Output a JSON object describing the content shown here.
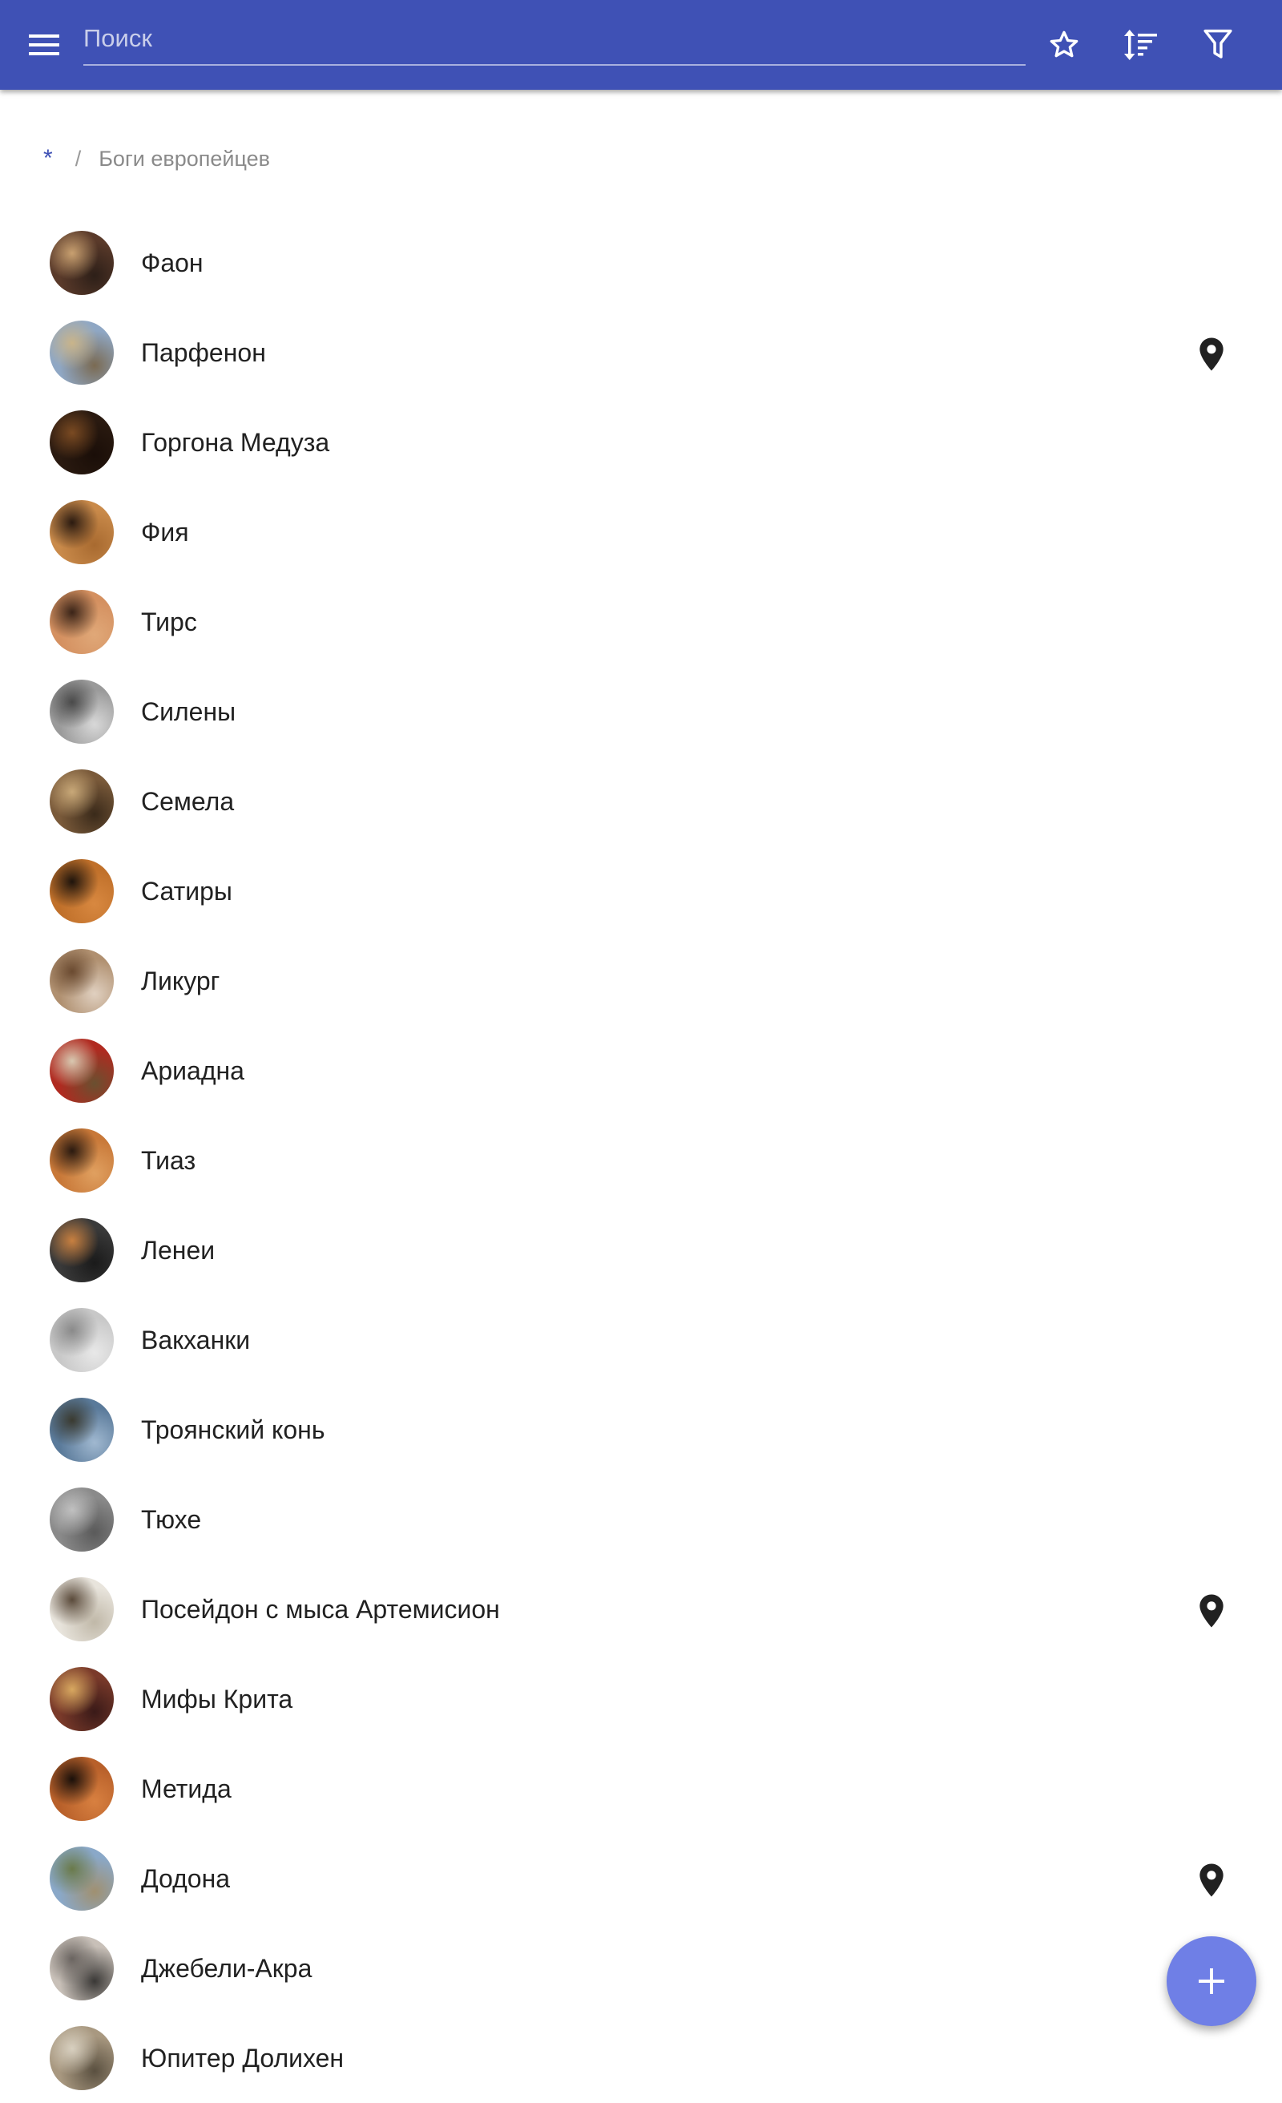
{
  "toolbar": {
    "menu_icon": "menu-icon",
    "search_placeholder": "Поиск",
    "search_value": "",
    "favorite_icon": "star-outline-icon",
    "sort_icon": "sort-icon",
    "filter_icon": "filter-icon",
    "accent": "#3f51b5"
  },
  "breadcrumb": {
    "root": "*",
    "separator": "/",
    "current": "Боги европейцев"
  },
  "items": [
    {
      "label": "Фаон",
      "has_pin": false,
      "colors": [
        "#5a3a2a",
        "#c8a070",
        "#2d1f18"
      ]
    },
    {
      "label": "Парфенон",
      "has_pin": true,
      "colors": [
        "#8fa7c4",
        "#c9b48a",
        "#7a6a52"
      ]
    },
    {
      "label": "Горгона Медуза",
      "has_pin": false,
      "colors": [
        "#2a1a10",
        "#7a4a22",
        "#1a0e08"
      ]
    },
    {
      "label": "Фия",
      "has_pin": false,
      "colors": [
        "#c98a4a",
        "#2a1a10",
        "#a86a30"
      ]
    },
    {
      "label": "Тирс",
      "has_pin": false,
      "colors": [
        "#d49060",
        "#3a2418",
        "#e0a878"
      ]
    },
    {
      "label": "Силены",
      "has_pin": false,
      "colors": [
        "#9a9a9a",
        "#4a4a4a",
        "#d8d8d8"
      ]
    },
    {
      "label": "Семела",
      "has_pin": false,
      "colors": [
        "#7a5a3a",
        "#c8a878",
        "#3a2a1a"
      ]
    },
    {
      "label": "Сатиры",
      "has_pin": false,
      "colors": [
        "#c0702a",
        "#1e140c",
        "#d88840"
      ]
    },
    {
      "label": "Ликург",
      "has_pin": false,
      "colors": [
        "#b09070",
        "#6a4a30",
        "#e0d0c0"
      ]
    },
    {
      "label": "Ариадна",
      "has_pin": false,
      "colors": [
        "#b02a20",
        "#d8c8b0",
        "#6a5030"
      ]
    },
    {
      "label": "Тиаз",
      "has_pin": false,
      "colors": [
        "#c87838",
        "#2a1a10",
        "#e0a060"
      ]
    },
    {
      "label": "Ленеи",
      "has_pin": false,
      "colors": [
        "#3a3a3a",
        "#c88040",
        "#1a1a1a"
      ]
    },
    {
      "label": "Вакханки",
      "has_pin": false,
      "colors": [
        "#c8c8c8",
        "#8a8a8a",
        "#e8e8e8"
      ]
    },
    {
      "label": "Троянский конь",
      "has_pin": false,
      "colors": [
        "#5a7a9a",
        "#3a3a30",
        "#a0b8d0"
      ]
    },
    {
      "label": "Тюхе",
      "has_pin": false,
      "colors": [
        "#8a8a8a",
        "#c0c0c0",
        "#5a5a5a"
      ]
    },
    {
      "label": "Посейдон с мыса Артемисион",
      "has_pin": true,
      "colors": [
        "#e8e4dc",
        "#5a4a3a",
        "#c0b8a8"
      ]
    },
    {
      "label": "Мифы Крита",
      "has_pin": false,
      "colors": [
        "#7a3a2a",
        "#d8a860",
        "#3a1a18"
      ]
    },
    {
      "label": "Метида",
      "has_pin": false,
      "colors": [
        "#b8602a",
        "#1a100a",
        "#d88040"
      ]
    },
    {
      "label": "Додона",
      "has_pin": true,
      "colors": [
        "#8aa8c8",
        "#6a7a4a",
        "#a09070"
      ]
    },
    {
      "label": "Джебели-Акра",
      "has_pin": false,
      "colors": [
        "#c8c0b8",
        "#6a6460",
        "#3a3836"
      ]
    },
    {
      "label": "Юпитер Долихен",
      "has_pin": false,
      "colors": [
        "#a89880",
        "#d8d0c0",
        "#5a5040"
      ]
    }
  ],
  "pin_icon": "location-pin-icon",
  "fab": {
    "icon": "plus-icon",
    "color": "#6f7fe6"
  }
}
